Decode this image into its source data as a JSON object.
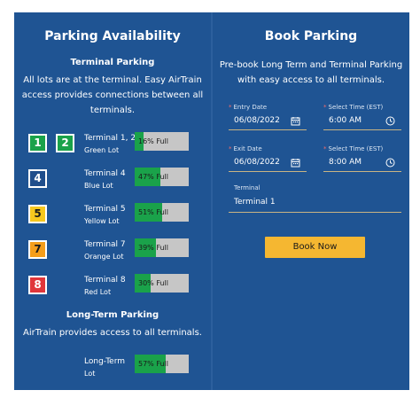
{
  "availability": {
    "title": "Parking Availability",
    "terminal_heading": "Terminal Parking",
    "terminal_desc_lines": [
      "All lots are at the terminal. Easy AirTrain",
      "access provides connections between all",
      "terminals."
    ],
    "lots": [
      {
        "badges": [
          "1",
          "2"
        ],
        "name": "Terminal 1, 2",
        "lot": "Green Lot",
        "percent": 16,
        "label": "16% Full",
        "color": "#1aa24a"
      },
      {
        "badges": [
          "4"
        ],
        "name": "Terminal 4",
        "lot": "Blue Lot",
        "percent": 47,
        "label": "47% Full",
        "color": "#1f4e8c"
      },
      {
        "badges": [
          "5"
        ],
        "name": "Terminal 5",
        "lot": "Yellow Lot",
        "percent": 51,
        "label": "51% Full",
        "color": "#f7c81e"
      },
      {
        "badges": [
          "7"
        ],
        "name": "Terminal 7",
        "lot": "Orange Lot",
        "percent": 39,
        "label": "39% Full",
        "color": "#f59e1b"
      },
      {
        "badges": [
          "8"
        ],
        "name": "Terminal 8",
        "lot": "Red Lot",
        "percent": 30,
        "label": "30% Full",
        "color": "#e0363b"
      }
    ],
    "longterm_heading": "Long-Term Parking",
    "longterm_desc": "AirTrain provides access to all terminals.",
    "longterm": {
      "name": "Long-Term",
      "lot": "Lot",
      "percent": 57,
      "label": "57% Full"
    }
  },
  "booking": {
    "title": "Book Parking",
    "desc_lines": [
      "Pre-book Long Term and Terminal Parking",
      "with easy access to all terminals."
    ],
    "entry_date_label": "Entry Date",
    "entry_date": "06/08/2022",
    "entry_time_label": "Select Time (EST)",
    "entry_time": "6:00 AM",
    "exit_date_label": "Exit Date",
    "exit_date": "06/08/2022",
    "exit_time_label": "Select Time (EST)",
    "exit_time": "8:00 AM",
    "terminal_label": "Terminal",
    "terminal_value": "Terminal 1",
    "button_label": "Book Now",
    "required_mark": "*"
  },
  "colors": {
    "panel": "#1f5493",
    "bar_fill": "#1aa24a",
    "bar_empty": "#c6c6c6",
    "button": "#f5b731"
  },
  "icons": {
    "date": "calendar-icon",
    "time": "clock-icon"
  }
}
